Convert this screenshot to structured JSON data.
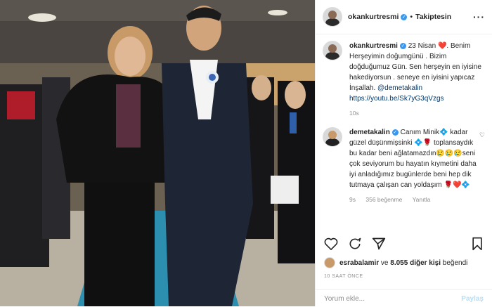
{
  "header": {
    "username": "okankurtresmi",
    "follow_state": "Takiptesin",
    "dot": "•"
  },
  "caption": {
    "username": "okankurtresmi",
    "text_before_mention": " 23 Nisan ❤️. Benim Herşeyimin doğumgünü . Bizim doğduğumuz Gün. Sen herşeyin en iyisine hakediyorsun . seneye en iyisini yapıcaz İnşallah. ",
    "mention": "@demetakalin",
    "url": "https://youtu.be/Sk7yG3qVzgs",
    "time": "10s"
  },
  "reply": {
    "username": "demetakalin",
    "text": " Canım Minik💠 kadar güzel düşünmişsinki 💠🌹 toplansaydık bu kadar beni ağlatamazdın😢😢😢seni çok seviyorum bu hayatın kıymetini daha iyi anladığımız bugünlerde beni hep dik tutmaya çalışan can yoldaşım 🌹❤️💠",
    "time": "9s",
    "likes": "356 beğenme",
    "reply_label": "Yanıtla"
  },
  "likes": {
    "first_liker": "esrabalamir",
    "joiner": " ve ",
    "others": "8.055 diğer kişi",
    "suffix": " beğendi"
  },
  "timestamp": "10 SAAT ÖNCE",
  "comment_box": {
    "placeholder": "Yorum ekle...",
    "post_label": "Paylaş"
  },
  "icons": [
    "more-icon",
    "heart-icon",
    "comment-icon",
    "share-icon",
    "bookmark-icon",
    "verified-icon"
  ],
  "colors": {
    "verified": "#3897f0",
    "post_disabled": "#b2dffc",
    "carpet": "#2d8fb0"
  }
}
